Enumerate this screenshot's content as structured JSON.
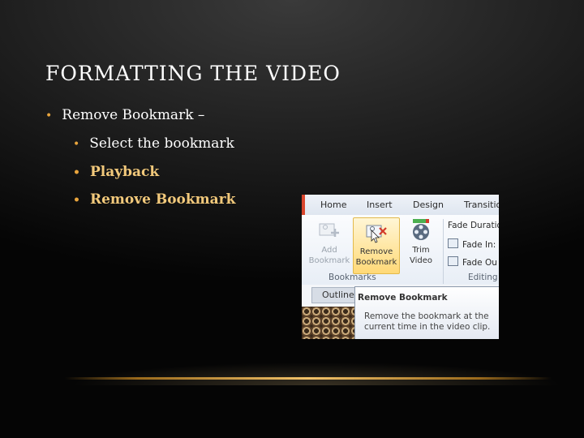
{
  "slide": {
    "title": "FORMATTING THE VIDEO",
    "bullets": [
      {
        "text": "Remove Bookmark –"
      },
      {
        "text": "Select the bookmark"
      },
      {
        "text": "Playback"
      },
      {
        "text": "Remove Bookmark"
      }
    ],
    "bullet_symbol": "•"
  },
  "colors": {
    "accent_gold": "#e9a53d",
    "highlight_text": "#f2c97b",
    "ribbon_highlight": "#ffd977"
  },
  "ribbon": {
    "tabs": [
      "Home",
      "Insert",
      "Design",
      "Transitio"
    ],
    "buttons": {
      "add_line1": "Add",
      "add_line2": "Bookmark",
      "remove_line1": "Remove",
      "remove_line2": "Bookmark",
      "trim_line1": "Trim",
      "trim_line2": "Video"
    },
    "groups": {
      "bookmarks": "Bookmarks",
      "editing": "Editing"
    },
    "editing_items": [
      "Fade Duratio",
      "Fade In:",
      "Fade Ou"
    ],
    "outline_tab": "Outline",
    "tooltip": {
      "title": "Remove Bookmark",
      "body": "Remove the bookmark at the current time in the video clip."
    }
  }
}
